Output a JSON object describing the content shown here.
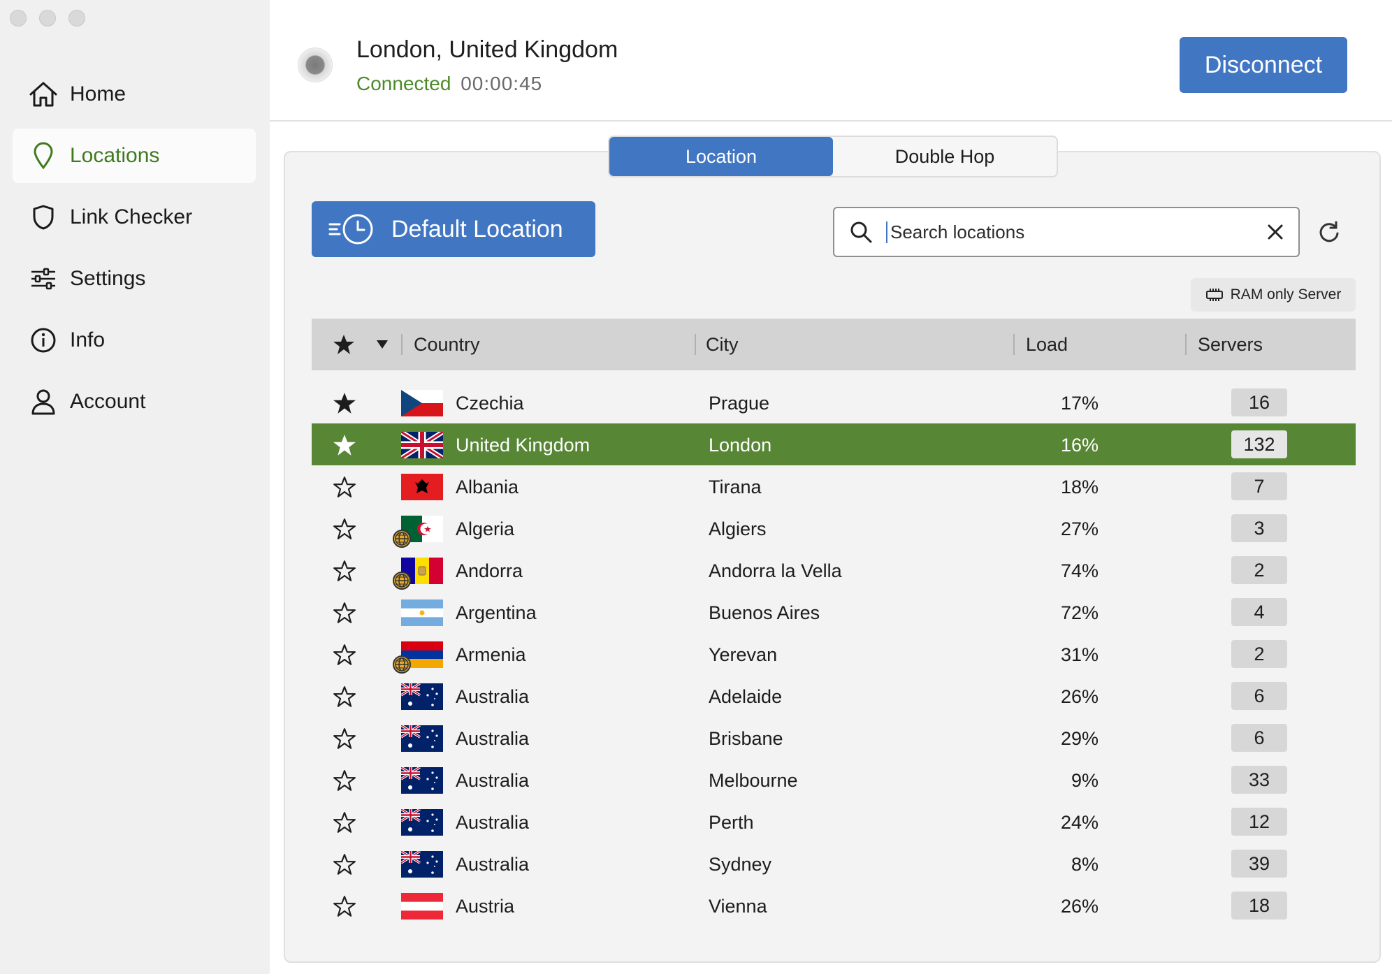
{
  "window": {
    "controls": [
      "close",
      "minimize",
      "zoom"
    ]
  },
  "sidebar": {
    "items": [
      {
        "label": "Home",
        "icon": "home-icon",
        "active": false
      },
      {
        "label": "Locations",
        "icon": "location-pin-icon",
        "active": true
      },
      {
        "label": "Link Checker",
        "icon": "shield-icon",
        "active": false
      },
      {
        "label": "Settings",
        "icon": "sliders-icon",
        "active": false
      },
      {
        "label": "Info",
        "icon": "info-icon",
        "active": false
      },
      {
        "label": "Account",
        "icon": "user-icon",
        "active": false
      }
    ]
  },
  "header": {
    "location": "London, United Kingdom",
    "status": "Connected",
    "timer": "00:00:45",
    "disconnect_label": "Disconnect"
  },
  "tabs": [
    {
      "label": "Location",
      "active": true
    },
    {
      "label": "Double Hop",
      "active": false
    }
  ],
  "default_location_label": "Default Location",
  "search": {
    "placeholder": "Search locations",
    "value": ""
  },
  "ram_badge": "RAM only Server",
  "table": {
    "columns": {
      "country": "Country",
      "city": "City",
      "load": "Load",
      "servers": "Servers"
    },
    "rows": [
      {
        "fav": true,
        "flag": "cz",
        "country": "Czechia",
        "city": "Prague",
        "load": "17%",
        "servers": "16",
        "selected": false,
        "virtual": false
      },
      {
        "fav": true,
        "flag": "gb",
        "country": "United Kingdom",
        "city": "London",
        "load": "16%",
        "servers": "132",
        "selected": true,
        "virtual": false
      },
      {
        "fav": false,
        "flag": "al",
        "country": "Albania",
        "city": "Tirana",
        "load": "18%",
        "servers": "7",
        "selected": false,
        "virtual": false
      },
      {
        "fav": false,
        "flag": "dz",
        "country": "Algeria",
        "city": "Algiers",
        "load": "27%",
        "servers": "3",
        "selected": false,
        "virtual": true
      },
      {
        "fav": false,
        "flag": "ad",
        "country": "Andorra",
        "city": "Andorra la Vella",
        "load": "74%",
        "servers": "2",
        "selected": false,
        "virtual": true
      },
      {
        "fav": false,
        "flag": "ar",
        "country": "Argentina",
        "city": "Buenos Aires",
        "load": "72%",
        "servers": "4",
        "selected": false,
        "virtual": false
      },
      {
        "fav": false,
        "flag": "am",
        "country": "Armenia",
        "city": "Yerevan",
        "load": "31%",
        "servers": "2",
        "selected": false,
        "virtual": true
      },
      {
        "fav": false,
        "flag": "au",
        "country": "Australia",
        "city": "Adelaide",
        "load": "26%",
        "servers": "6",
        "selected": false,
        "virtual": false
      },
      {
        "fav": false,
        "flag": "au",
        "country": "Australia",
        "city": "Brisbane",
        "load": "29%",
        "servers": "6",
        "selected": false,
        "virtual": false
      },
      {
        "fav": false,
        "flag": "au",
        "country": "Australia",
        "city": "Melbourne",
        "load": "9%",
        "servers": "33",
        "selected": false,
        "virtual": false
      },
      {
        "fav": false,
        "flag": "au",
        "country": "Australia",
        "city": "Perth",
        "load": "24%",
        "servers": "12",
        "selected": false,
        "virtual": false
      },
      {
        "fav": false,
        "flag": "au",
        "country": "Australia",
        "city": "Sydney",
        "load": "8%",
        "servers": "39",
        "selected": false,
        "virtual": false
      },
      {
        "fav": false,
        "flag": "at",
        "country": "Austria",
        "city": "Vienna",
        "load": "26%",
        "servers": "18",
        "selected": false,
        "virtual": false
      }
    ]
  },
  "colors": {
    "accent_blue": "#4176c2",
    "selected_row": "#578735",
    "connected_green": "#4d8a2a",
    "active_nav_text": "#3f7a1e"
  }
}
